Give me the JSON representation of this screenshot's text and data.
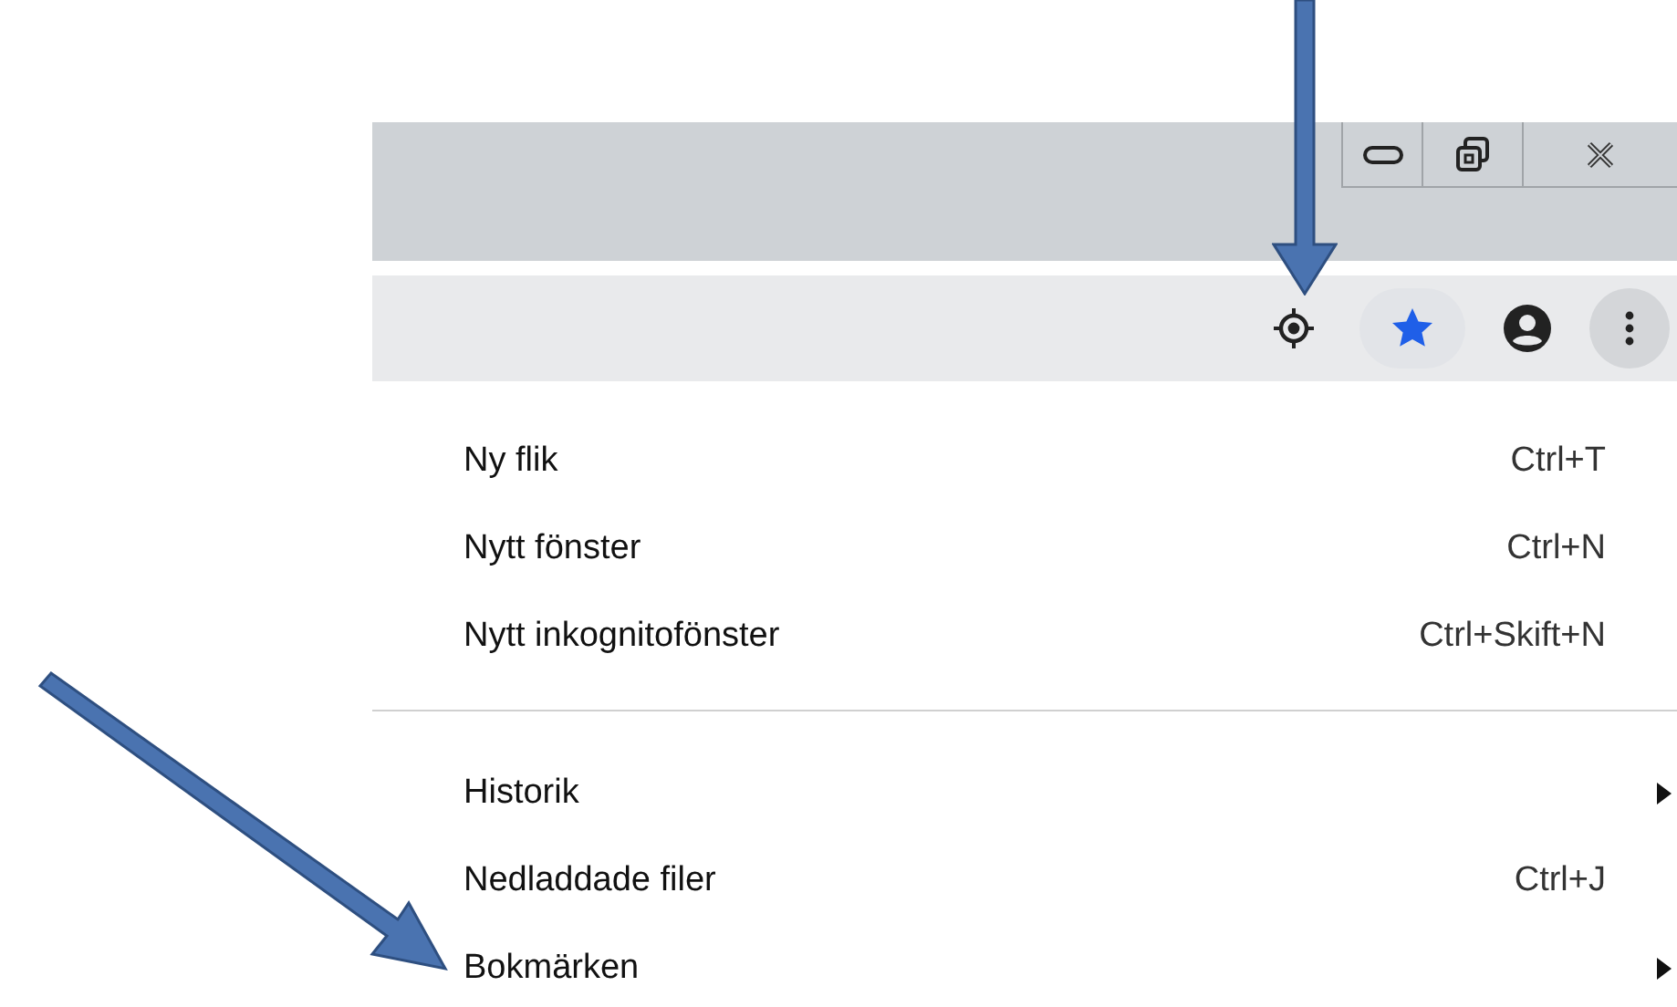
{
  "menu": {
    "groups": [
      [
        {
          "label": "Ny flik",
          "shortcut": "Ctrl+T",
          "has_submenu": false
        },
        {
          "label": "Nytt fönster",
          "shortcut": "Ctrl+N",
          "has_submenu": false
        },
        {
          "label": "Nytt inkognitofönster",
          "shortcut": "Ctrl+Skift+N",
          "has_submenu": false
        }
      ],
      [
        {
          "label": "Historik",
          "has_submenu": true
        },
        {
          "label": "Nedladdade filer",
          "shortcut": "Ctrl+J",
          "has_submenu": false
        },
        {
          "label": "Bokmärken",
          "has_submenu": true
        }
      ]
    ]
  }
}
